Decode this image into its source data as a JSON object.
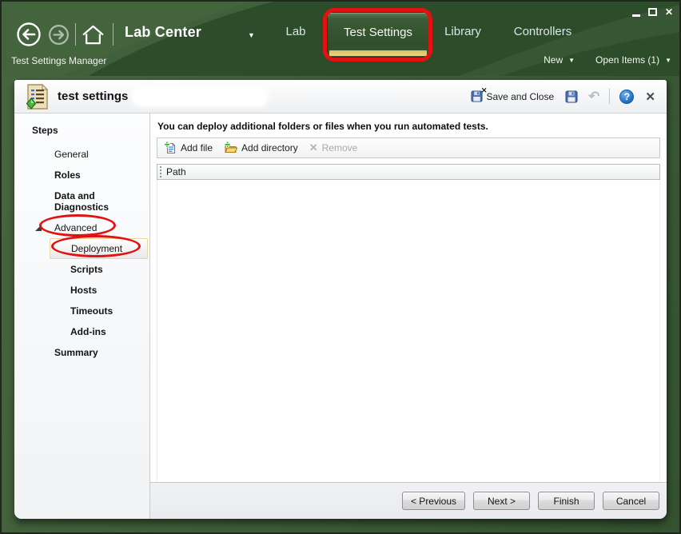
{
  "glyphs": {
    "caret_down": "▼",
    "close_x": "✕",
    "win_close": "✕",
    "undo": "↶",
    "question": "?",
    "remove_x": "✕"
  },
  "nav": {
    "center_switcher": {
      "label": "Lab Center"
    },
    "tabs": [
      {
        "label": "Lab",
        "selected": false
      },
      {
        "label": "Test Settings",
        "selected": true,
        "annotated": true
      },
      {
        "label": "Library",
        "selected": false
      },
      {
        "label": "Controllers",
        "selected": false
      }
    ]
  },
  "subbar": {
    "title": "Test Settings Manager",
    "menus": [
      {
        "label": "New"
      },
      {
        "label": "Open Items (1)"
      }
    ]
  },
  "editor": {
    "title": "test settings",
    "actions": {
      "save_and_close": "Save and Close"
    }
  },
  "steps": {
    "header": "Steps",
    "items": [
      {
        "label": "General",
        "bold": false,
        "level": 1
      },
      {
        "label": "Roles",
        "bold": true,
        "level": 1
      },
      {
        "label": "Data and Diagnostics",
        "bold": true,
        "level": 1
      },
      {
        "label": "Advanced",
        "bold": false,
        "level": 1,
        "expanded": true,
        "annotated": true
      },
      {
        "label": "Deployment",
        "bold": false,
        "level": 2,
        "selected": true,
        "annotated": true
      },
      {
        "label": "Scripts",
        "bold": true,
        "level": 2
      },
      {
        "label": "Hosts",
        "bold": true,
        "level": 2
      },
      {
        "label": "Timeouts",
        "bold": true,
        "level": 2
      },
      {
        "label": "Add-ins",
        "bold": true,
        "level": 2
      },
      {
        "label": "Summary",
        "bold": true,
        "level": 1
      }
    ]
  },
  "content": {
    "instruction": "You can deploy additional folders or files when you run automated tests.",
    "toolbar": [
      {
        "label": "Add file",
        "icon": "add-file",
        "disabled": false
      },
      {
        "label": "Add directory",
        "icon": "add-directory",
        "disabled": false
      },
      {
        "label": "Remove",
        "icon": "remove-x",
        "disabled": true
      }
    ],
    "table": {
      "columns": [
        "Path"
      ],
      "rows": []
    }
  },
  "footer": {
    "buttons": [
      {
        "label": "< Previous"
      },
      {
        "label": "Next >"
      },
      {
        "label": "Finish"
      },
      {
        "label": "Cancel"
      }
    ]
  },
  "annotations": {
    "highlight_color": "#e01212",
    "targets": [
      "Test Settings tab",
      "Advanced step",
      "Deployment step"
    ]
  },
  "colors": {
    "header_green": "#2d4d2a",
    "body_green": "#3e5e38",
    "tab_gold": "#e4c977",
    "annotation_red": "#e01212",
    "help_blue": "#1e6cc2"
  }
}
